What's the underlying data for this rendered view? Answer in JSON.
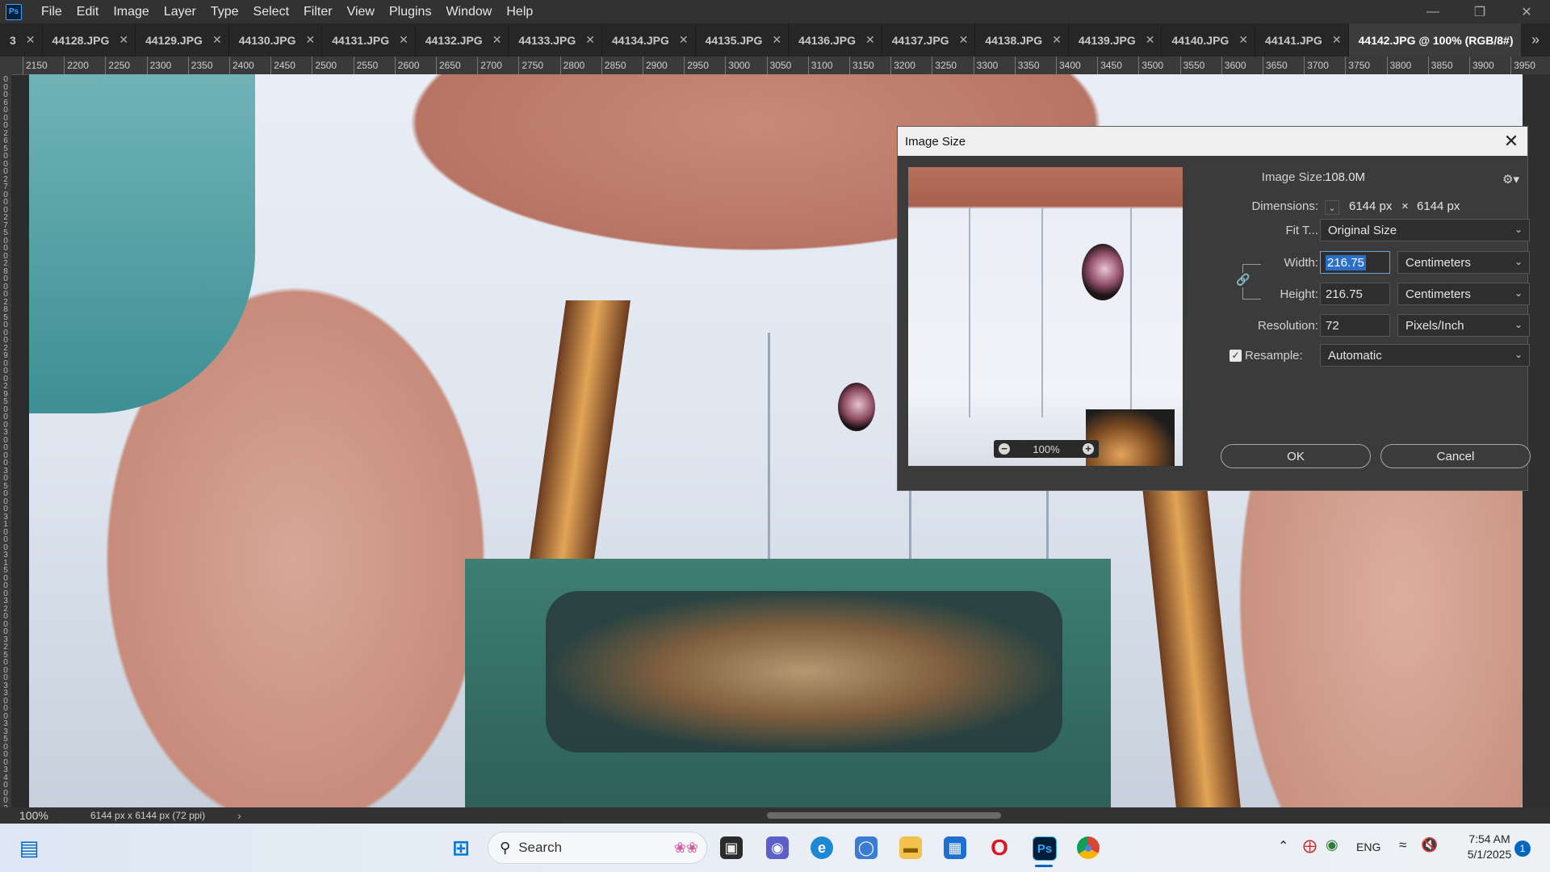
{
  "menubar": {
    "logo": "Ps",
    "items": [
      "File",
      "Edit",
      "Image",
      "Layer",
      "Type",
      "Select",
      "Filter",
      "View",
      "Plugins",
      "Window",
      "Help"
    ]
  },
  "tabs": [
    {
      "label": "3"
    },
    {
      "label": "44128.JPG"
    },
    {
      "label": "44129.JPG"
    },
    {
      "label": "44130.JPG"
    },
    {
      "label": "44131.JPG"
    },
    {
      "label": "44132.JPG"
    },
    {
      "label": "44133.JPG"
    },
    {
      "label": "44134.JPG"
    },
    {
      "label": "44135.JPG"
    },
    {
      "label": "44136.JPG"
    },
    {
      "label": "44137.JPG"
    },
    {
      "label": "44138.JPG"
    },
    {
      "label": "44139.JPG"
    },
    {
      "label": "44140.JPG"
    },
    {
      "label": "44141.JPG"
    },
    {
      "label": "44142.JPG @ 100% (RGB/8#)",
      "active": true
    }
  ],
  "ruler_top": [
    "2150",
    "2200",
    "2250",
    "2300",
    "2350",
    "2400",
    "2450",
    "2500",
    "2550",
    "2600",
    "2650",
    "2700",
    "2750",
    "2800",
    "2850",
    "2900",
    "2950",
    "3000",
    "3050",
    "3100",
    "3150",
    "3200",
    "3250",
    "3300",
    "3350",
    "3400",
    "3450",
    "3500",
    "3550",
    "3600",
    "3650",
    "3700",
    "3750",
    "3800",
    "3850",
    "3900",
    "3950"
  ],
  "ruler_left": [
    "0",
    "0",
    "0",
    "6",
    "0",
    "0",
    "0",
    "2",
    "6",
    "5",
    "0",
    "0",
    "0",
    "2",
    "7",
    "0",
    "0",
    "0",
    "2",
    "7",
    "5",
    "0",
    "0",
    "0",
    "2",
    "8",
    "0",
    "0",
    "0",
    "2",
    "8",
    "5",
    "0",
    "0",
    "0",
    "2",
    "9",
    "0",
    "0",
    "0",
    "2",
    "9",
    "5",
    "0",
    "0",
    "0",
    "3",
    "0",
    "0",
    "0",
    "0",
    "3",
    "0",
    "5",
    "0",
    "0",
    "0",
    "3",
    "1",
    "0",
    "0",
    "0",
    "3",
    "1",
    "5",
    "0",
    "0",
    "0",
    "3",
    "2",
    "0",
    "0",
    "0",
    "3",
    "2",
    "5",
    "0",
    "0",
    "0",
    "3",
    "3",
    "0",
    "0",
    "0",
    "3",
    "3",
    "5",
    "0",
    "0",
    "0",
    "3",
    "4",
    "0",
    "0",
    "0",
    "3",
    "4",
    "5",
    "0"
  ],
  "dialog": {
    "title": "Image Size",
    "image_size_label": "Image Size:",
    "image_size_value": "108.0M",
    "dimensions_label": "Dimensions:",
    "dim_width": "6144 px",
    "dim_times": "×",
    "dim_height": "6144 px",
    "fit_label": "Fit T...",
    "fit_value": "Original Size",
    "width_label": "Width:",
    "width_value": "216.75",
    "width_unit": "Centimeters",
    "height_label": "Height:",
    "height_value": "216.75",
    "height_unit": "Centimeters",
    "resolution_label": "Resolution:",
    "resolution_value": "72",
    "resolution_unit": "Pixels/Inch",
    "resample_label": "Resample:",
    "resample_checked": true,
    "resample_value": "Automatic",
    "preview_zoom": "100%",
    "ok_label": "OK",
    "cancel_label": "Cancel"
  },
  "statusbar": {
    "zoom": "100%",
    "doc_info": "6144 px x 6144 px (72 ppi)",
    "arrow": "›"
  },
  "taskbar": {
    "search_label": "Search",
    "language": "ENG",
    "time": "7:54 AM",
    "date": "5/1/2025",
    "notification_count": "1",
    "photoshop_label": "Ps"
  },
  "colors": {
    "accent": "#31a8ff",
    "focus": "#6e9fd6",
    "selection": "#2c6fc9",
    "taskbar_badge": "#0067c0"
  }
}
